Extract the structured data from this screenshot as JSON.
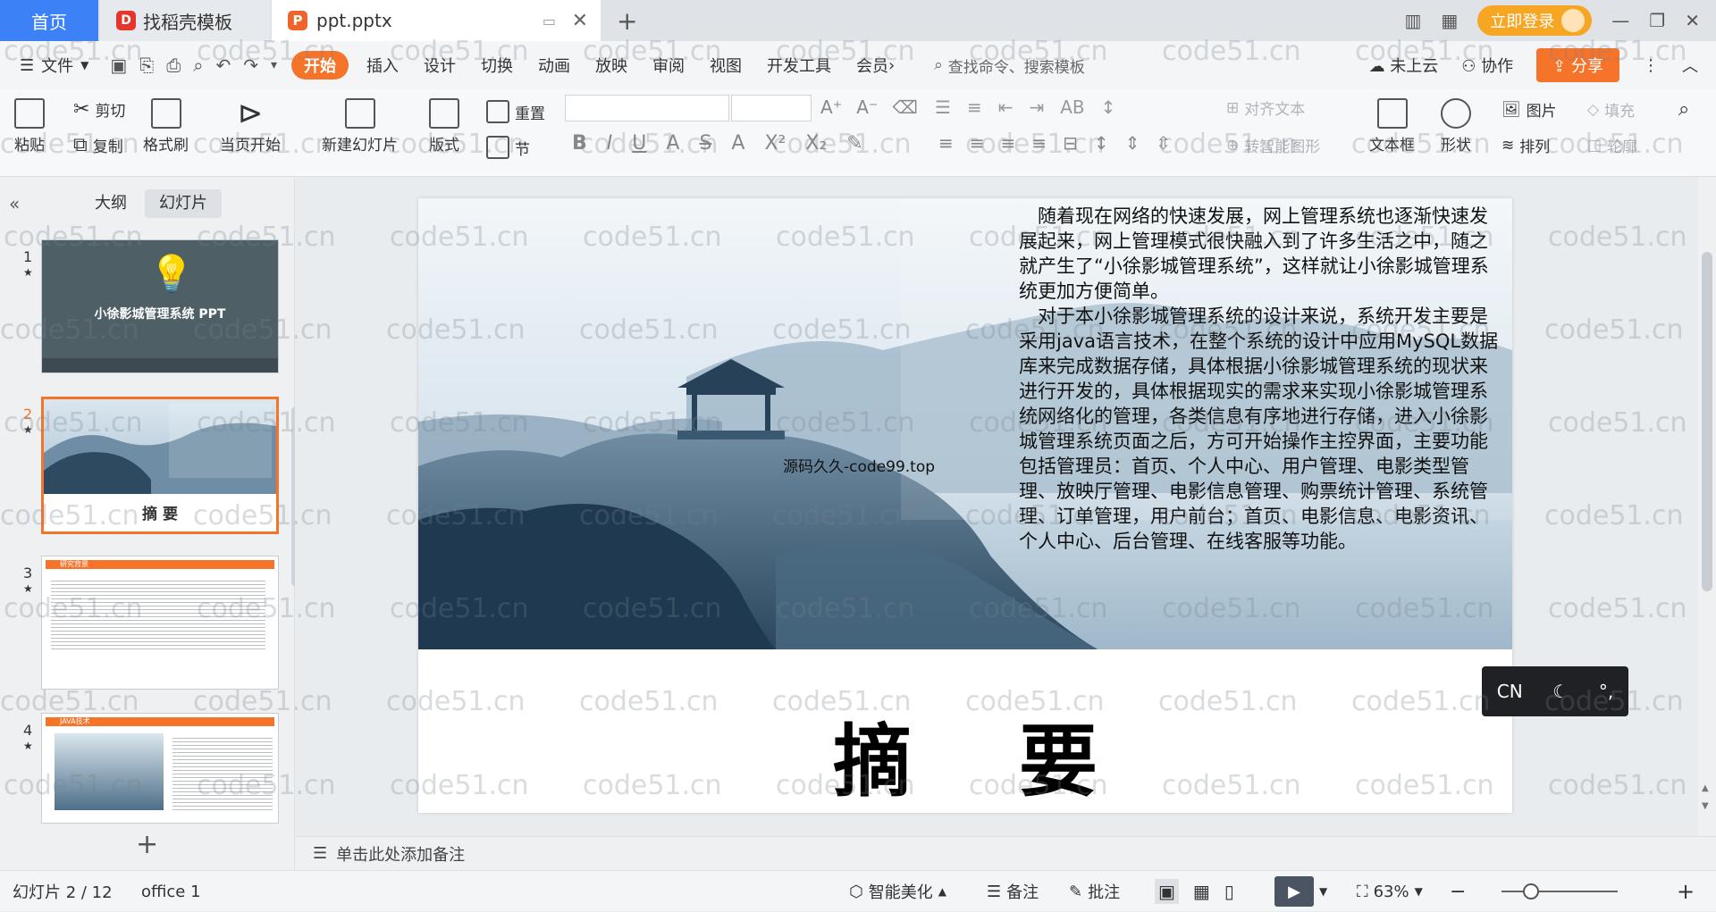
{
  "tabs": {
    "home": "首页",
    "template": "找稻壳模板",
    "document": "ppt.pptx"
  },
  "window": {
    "login": "立即登录"
  },
  "menu": {
    "file": "文件",
    "items": [
      "开始",
      "插入",
      "设计",
      "切换",
      "动画",
      "放映",
      "审阅",
      "视图",
      "开发工具",
      "会员"
    ],
    "search_placeholder": "查找命令、搜索模板",
    "cloud": "未上云",
    "collab": "协作",
    "share": "分享"
  },
  "ribbon": {
    "paste": "粘贴",
    "cut": "剪切",
    "copy": "复制",
    "format_painter": "格式刷",
    "play_current": "当页开始",
    "new_slide": "新建幻灯片",
    "layout": "版式",
    "reset": "重置",
    "section": "节",
    "align_text": "对齐文本",
    "smart_graphic": "转智能图形",
    "text_box": "文本框",
    "shape": "形状",
    "picture": "图片",
    "fill": "填充",
    "arrange": "排列",
    "outline": "轮廓"
  },
  "sidebar": {
    "tab_outline": "大纲",
    "tab_slides": "幻灯片",
    "slides": [
      {
        "num": "1",
        "title": "小徐影城管理系统  PPT"
      },
      {
        "num": "2",
        "title": "摘    要"
      },
      {
        "num": "3",
        "title": "研究背景"
      },
      {
        "num": "4",
        "title": "JAVA技术"
      }
    ]
  },
  "slide": {
    "paragraph1": "随着现在网络的快速发展，网上管理系统也逐渐快速发展起来，网上管理模式很快融入到了许多生活之中，随之就产生了“小徐影城管理系统”，这样就让小徐影城管理系统更加方便简单。",
    "paragraph2": "对于本小徐影城管理系统的设计来说，系统开发主要是采用java语言技术，在整个系统的设计中应用MySQL数据库来完成数据存储，具体根据小徐影城管理系统的现状来进行开发的，具体根据现实的需求来实现小徐影城管理系统网络化的管理，各类信息有序地进行存储，进入小徐影城管理系统页面之后，方可开始操作主控界面，主要功能包括管理员：首页、个人中心、用户管理、电影类型管理、放映厅管理、电影信息管理、购票统计管理、系统管理、订单管理，用户前台；首页、电影信息、电影资讯、个人中心、后台管理、在线客服等功能。",
    "source_mark": "源码久久-code99.top",
    "title_left": "摘",
    "title_right": "要"
  },
  "ime": {
    "lang": "CN"
  },
  "notes": {
    "placeholder": "单击此处添加备注"
  },
  "status": {
    "slide_counter": "幻灯片 2 / 12",
    "theme": "office 1",
    "beautify": "智能美化",
    "notes": "备注",
    "comment": "批注",
    "zoom": "63%"
  },
  "watermark": "code51.cn",
  "colors": {
    "accent": "#f5742a",
    "tab_home": "#3c82f6"
  }
}
